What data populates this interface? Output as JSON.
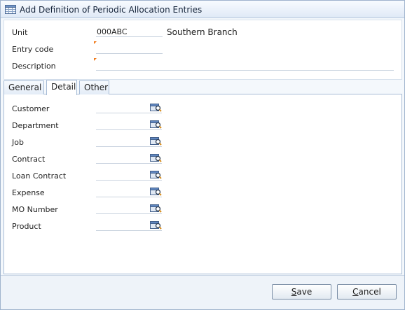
{
  "window": {
    "title": "Add Definition of Periodic Allocation Entries",
    "icon": "grid-form-icon"
  },
  "header": {
    "unit_label": "Unit",
    "unit_value": "000ABC",
    "unit_name": "Southern Branch",
    "entry_code_label": "Entry code",
    "entry_code_value": "",
    "description_label": "Description",
    "description_value": "",
    "required_marker_color": "#f07a1a"
  },
  "tabs": [
    {
      "label": "General",
      "active": false
    },
    {
      "label": "Detail",
      "active": true
    },
    {
      "label": "Other",
      "active": false
    }
  ],
  "detail": {
    "fields": [
      {
        "label": "Customer",
        "value": "",
        "icon": "lookup-icon"
      },
      {
        "label": "Department",
        "value": "",
        "icon": "lookup-icon"
      },
      {
        "label": "Job",
        "value": "",
        "icon": "lookup-icon"
      },
      {
        "label": "Contract",
        "value": "",
        "icon": "lookup-icon"
      },
      {
        "label": "Loan Contract",
        "value": "",
        "icon": "lookup-icon"
      },
      {
        "label": "Expense",
        "value": "",
        "icon": "lookup-icon"
      },
      {
        "label": "MO Number",
        "value": "",
        "icon": "lookup-icon"
      },
      {
        "label": "Product",
        "value": "",
        "icon": "lookup-icon"
      }
    ]
  },
  "footer": {
    "save_first": "S",
    "save_rest": "ave",
    "cancel_first": "C",
    "cancel_rest": "ancel"
  }
}
